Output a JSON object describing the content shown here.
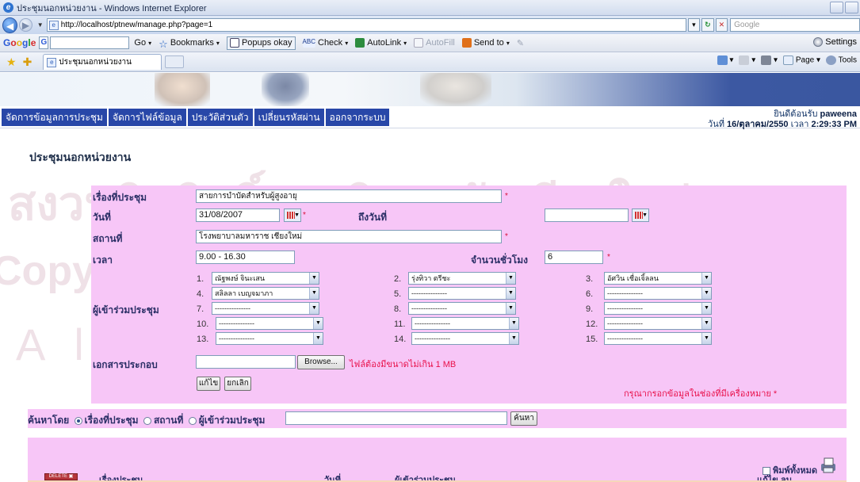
{
  "browser": {
    "window_title": "ประชุมนอกหน่วยงาน - Windows Internet Explorer",
    "url": "http://localhost/ptnew/manage.php?page=1",
    "search_placeholder": "Google",
    "google_toolbar": {
      "logo_letters": [
        "G",
        "o",
        "o",
        "g",
        "l",
        "e"
      ],
      "g_button": "G",
      "go_label": "Go",
      "bookmarks": "Bookmarks",
      "popups": "Popups okay",
      "check": "Check",
      "autolink": "AutoLink",
      "autofill": "AutoFill",
      "send_to": "Send to",
      "settings": "Settings"
    },
    "tab_title": "ประชุมนอกหน่วยงาน",
    "command_bar": {
      "page": "Page",
      "tools": "Tools"
    }
  },
  "site": {
    "menu": [
      "จัดการข้อมูลการประชุม",
      "จัดการไฟล์ข้อมูล",
      "ประวัติส่วนตัว",
      "เปลี่ยนรหัสผ่าน",
      "ออกจากระบบ"
    ],
    "welcome_prefix": "ยินดีต้อนรับ",
    "welcome_user": "paweena",
    "date_prefix": "วันที่",
    "date_value": "16/ตุลาคม/2550",
    "time_prefix": "เวลา",
    "time_value": "2:29:33 PM"
  },
  "page_title": "ประชุมนอกหน่วยงาน",
  "watermark": {
    "line1": "สงวนลิขสิทธิ์มหาวิทยาลัยเชียงใหม่",
    "line2": "Copyright© by Chiang Mai University",
    "line3": "All rights reserved"
  },
  "form": {
    "topic_label": "เรื่องที่ประชุม",
    "topic_value": "สายการบำบัดสำหรับผู้สูงอายุ",
    "date_label": "วันที่",
    "date_value": "31/08/2007",
    "to_date_label": "ถึงวันที่",
    "to_date_value": "",
    "place_label": "สถานที่",
    "place_value": "โรงพยาบาลมหาราช เชียงใหม่",
    "time_label": "เวลา",
    "time_value": "9.00 - 16.30",
    "hours_label": "จำนวนชั่วโมง",
    "hours_value": "6",
    "attendees_label": "ผู้เข้าร่วมประชุม",
    "attendees": [
      {
        "n": "1.",
        "v": "ณัฐพงษ์ จินะเสน"
      },
      {
        "n": "2.",
        "v": "รุ่งทิวา ตรีชะ"
      },
      {
        "n": "3.",
        "v": "อัศวิน เชื่อเจิ้ลลน"
      },
      {
        "n": "4.",
        "v": "สลิลลา เบญจมาภา"
      },
      {
        "n": "5.",
        "v": "---------------"
      },
      {
        "n": "6.",
        "v": "---------------"
      },
      {
        "n": "7.",
        "v": "---------------"
      },
      {
        "n": "8.",
        "v": "---------------"
      },
      {
        "n": "9.",
        "v": "---------------"
      },
      {
        "n": "10.",
        "v": "---------------"
      },
      {
        "n": "11.",
        "v": "---------------"
      },
      {
        "n": "12.",
        "v": "---------------"
      },
      {
        "n": "13.",
        "v": "---------------"
      },
      {
        "n": "14.",
        "v": "---------------"
      },
      {
        "n": "15.",
        "v": "---------------"
      }
    ],
    "attachment_label": "เอกสารประกอบ",
    "browse_label": "Browse...",
    "file_limit_note": "ไฟล์ต้องมีขนาดไม่เกิน 1 MB",
    "edit_button": "แก้ไข",
    "cancel_button": "ยกเลิก",
    "required_note": "กรุณากรอกข้อมูลในช่องที่มีเครื่องหมาย *",
    "required_mark": "*"
  },
  "search": {
    "label": "ค้นหาโดย",
    "options": [
      "เรื่องที่ประชุม",
      "สถานที่",
      "ผู้เข้าร่วมประชุม"
    ],
    "selected": "เรื่องที่ประชุม",
    "query": "",
    "button": "ค้นหา"
  },
  "list": {
    "delete_button": "DELETE",
    "col_topic": "เรื่องประชุม",
    "col_date": "วันที่",
    "col_attendees": "ผู้เข้าร่วมประชุม",
    "print_all": "พิมพ์ทั้งหมด",
    "col_edit": "แก้ไข",
    "col_delete": "ลบ"
  },
  "colors": {
    "menu_bg": "#2847a8",
    "form_bg": "#f7c6f7",
    "required": "#d8103a",
    "label": "#2b2f66"
  }
}
